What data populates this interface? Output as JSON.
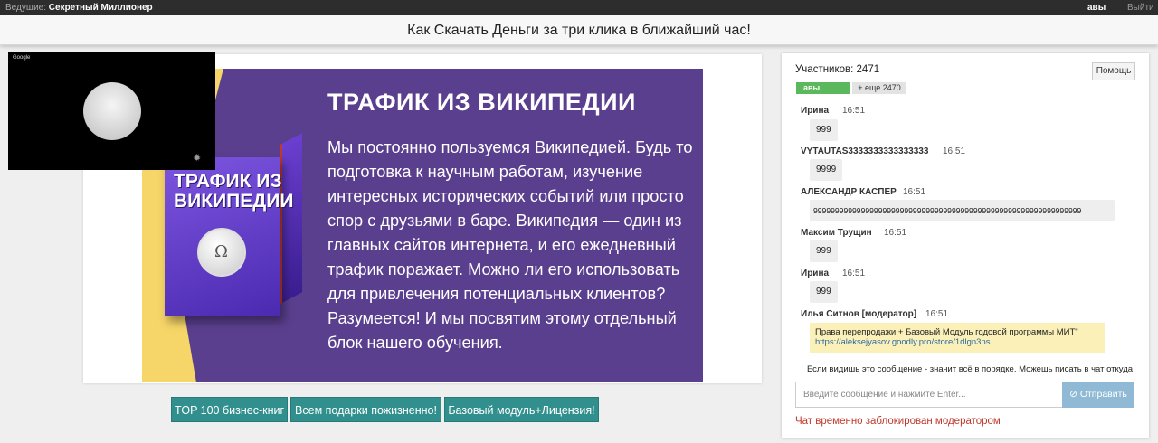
{
  "topbar": {
    "host_label": "Ведущие:",
    "host_name": "Секретный Миллионер",
    "user": "авы",
    "logout": "Выйти"
  },
  "title": "Как Скачать Деньги за три клика в ближайший час!",
  "video": {
    "brand": "Google",
    "settings_icon": "gear-icon"
  },
  "slide": {
    "heading": "ТРАФИК ИЗ ВИКИПЕДИИ",
    "body": "Мы постоянно пользуемся Википедией. Будь то подготовка к научным работам, изучение интересных исторических событий или просто спор с друзьями в баре. Википедия — один из главных сайтов интернета, и его ежедневный трафик поражает. Можно ли его использовать для привлечения потенциальных клиентов? Разумеется! И мы посвятим этому отдельный блок нашего обучения.",
    "box_title_line1": "ТРАФИК ИЗ",
    "box_title_line2": "ВИКИПЕДИИ",
    "globe_glyph": "Ω"
  },
  "buttons": [
    "TOP 100 бизнес-книг",
    "Всем подарки пожизненно!",
    "Базовый модуль+Лицензия!"
  ],
  "chat": {
    "participants": "Участников: 2471",
    "help": "Помощь",
    "badge_user": "авы",
    "badge_more": "+ еще 2470",
    "messages": [
      {
        "name": "Ирина",
        "time": "16:51",
        "text": "999"
      },
      {
        "name": "VYTAUTAS3333333333333333",
        "time": "16:51",
        "text": "9999"
      },
      {
        "name": "АЛЕКСАНДР КАСПЕР",
        "time": "16:51",
        "text": "99999999999999999999999999999999999999999999999999999999999999"
      },
      {
        "name": "Максим Трущин",
        "time": "16:51",
        "text": "999"
      },
      {
        "name": "Ирина",
        "time": "16:51",
        "text": "999"
      }
    ],
    "moderator": {
      "name": "Илья Ситнов [модератор]",
      "time": "16:51",
      "text": "Права перепродажи + Базовый Модуль годовой программы МИТ\"",
      "link": "https://aleksejyasov.goodly.pro/store/1dlgn3ps"
    },
    "notice": "Если видишь это сообщение - значит всё в порядке. Можешь писать в чат откуда",
    "input_placeholder": "Введите сообщение и нажмите Enter...",
    "send_icon": "check-circle-icon",
    "send_label": "Отправить",
    "blocked": "Чат временно заблокирован модератором"
  }
}
